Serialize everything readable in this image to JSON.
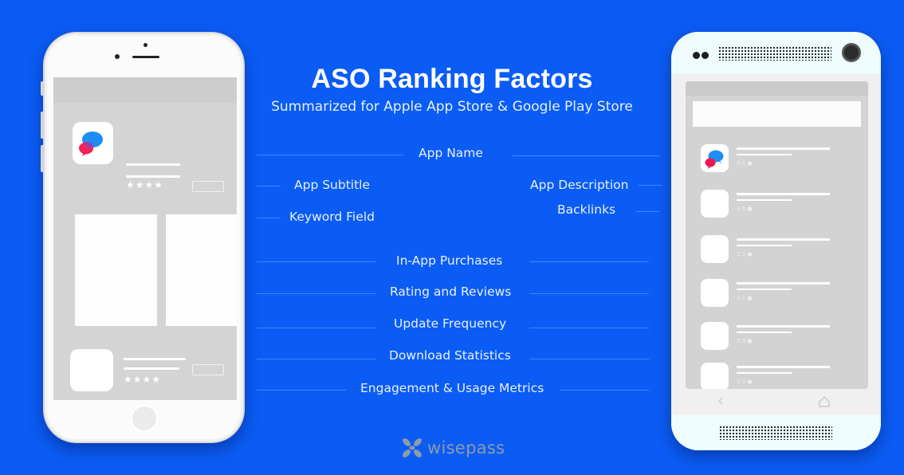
{
  "header": {
    "title": "ASO Ranking Factors",
    "subtitle": "Summarized for Apple App Store & Google Play Store"
  },
  "factors": {
    "app_name": "App Name",
    "app_subtitle": "App Subtitle",
    "keyword_field": "Keyword Field",
    "app_description": "App Description",
    "backlinks": "Backlinks",
    "in_app_purchases": "In-App Purchases",
    "rating_and_reviews": "Rating and Reviews",
    "update_frequency": "Update Frequency",
    "download_statistics": "Download Statistics",
    "engagement_usage_metrics": "Engagement & Usage Metrics"
  },
  "iphone_mockup": {
    "featured_app": {
      "stars": "★★★★",
      "icon": "chat-bubbles-icon"
    },
    "second_app": {
      "stars": "★★★★"
    }
  },
  "android_mockup": {
    "list": [
      {
        "rating": "4.5 ●",
        "icon": "chat-bubbles-icon"
      },
      {
        "rating": "3.8 ●"
      },
      {
        "rating": "3.5 ●"
      },
      {
        "rating": "4.2 ●"
      },
      {
        "rating": "3.9 ●"
      },
      {
        "rating": "3.9 ●"
      }
    ],
    "nav": {
      "back_icon": "‹",
      "home_icon": "home-icon"
    }
  },
  "brand": {
    "name": "wisepass",
    "logo_icon": "wisepass-logo-icon"
  },
  "colors": {
    "background": "#0b5cf5",
    "bubble_blue": "#1e8df5",
    "bubble_red": "#f0174f",
    "logo_gray": "#8f9aa8"
  }
}
